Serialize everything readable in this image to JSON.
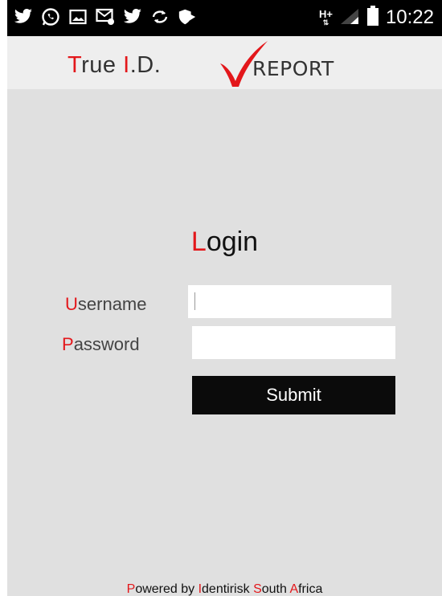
{
  "status_bar": {
    "icons": [
      "twitter-icon",
      "whatsapp-icon",
      "image-icon",
      "message-icon",
      "twitter-icon",
      "sync-icon",
      "shield-icon"
    ],
    "network_type": "H+",
    "network_arrows": "⇅",
    "time": "10:22"
  },
  "header": {
    "brand_first": "T",
    "brand_rest": "rue ",
    "brand_i": "I",
    "brand_end": ".D.",
    "logo_text": "REPORT"
  },
  "login": {
    "title_first": "L",
    "title_rest": "ogin",
    "username_first": "U",
    "username_rest": "sername",
    "username_value": "",
    "password_first": "P",
    "password_rest": "assword",
    "password_value": "",
    "submit_label": "Submit"
  },
  "footer": {
    "p1": "P",
    "w1": "owered by ",
    "p2": "I",
    "w2": "dentirisk ",
    "p3": "S",
    "w3": "outh ",
    "p4": "A",
    "w4": "frica"
  },
  "colors": {
    "accent": "#e3171b",
    "background": "#e0e0e0",
    "button": "#0b0b0b"
  }
}
